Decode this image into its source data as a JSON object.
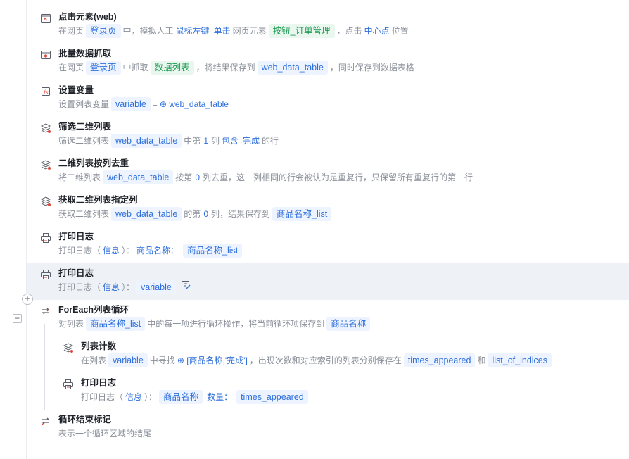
{
  "steps": [
    {
      "title": "点击元素(web)",
      "parts": [
        [
          "t",
          "在网页"
        ],
        [
          "tag",
          "登录页"
        ],
        [
          "t",
          "中，模拟人工"
        ],
        [
          "kw",
          "鼠标左键"
        ],
        [
          "kw",
          "单击"
        ],
        [
          "t",
          "网页元素"
        ],
        [
          "tg",
          "按钮_订单管理"
        ],
        [
          "t",
          "，点击"
        ],
        [
          "kw",
          "中心点"
        ],
        [
          "t",
          "位置"
        ]
      ]
    },
    {
      "title": "批量数据抓取",
      "parts": [
        [
          "t",
          "在网页"
        ],
        [
          "tag",
          "登录页"
        ],
        [
          "t",
          "中抓取"
        ],
        [
          "tg",
          "数据列表"
        ],
        [
          "t",
          "，将结果保存到"
        ],
        [
          "tag",
          "web_data_table"
        ],
        [
          "t",
          "，同时保存到数据表格"
        ]
      ]
    },
    {
      "title": "设置变量",
      "parts": [
        [
          "t",
          "设置列表变量"
        ],
        [
          "tag",
          "variable"
        ],
        [
          "t",
          "="
        ],
        [
          "kwi",
          "web_data_table"
        ]
      ]
    },
    {
      "title": "筛选二维列表",
      "parts": [
        [
          "t",
          "筛选二维列表"
        ],
        [
          "tag",
          "web_data_table"
        ],
        [
          "t",
          "中第"
        ],
        [
          "num",
          "1"
        ],
        [
          "t",
          "列"
        ],
        [
          "kw",
          "包含"
        ],
        [
          "kw",
          "完成"
        ],
        [
          "t",
          "的行"
        ]
      ]
    },
    {
      "title": "二维列表按列去重",
      "parts": [
        [
          "t",
          "将二维列表"
        ],
        [
          "tag",
          "web_data_table"
        ],
        [
          "t",
          "按第"
        ],
        [
          "num",
          "0"
        ],
        [
          "t",
          "列去重，这一列相同的行会被认为是重复行，只保留所有重复行的第一行"
        ]
      ]
    },
    {
      "title": "获取二维列表指定列",
      "parts": [
        [
          "t",
          "获取二维列表"
        ],
        [
          "tag",
          "web_data_table"
        ],
        [
          "t",
          "的第"
        ],
        [
          "num",
          "0"
        ],
        [
          "t",
          "列，结果保存到"
        ],
        [
          "tag",
          "商品名称_list"
        ]
      ]
    },
    {
      "title": "打印日志",
      "parts": [
        [
          "t",
          "打印日志（"
        ],
        [
          "kw",
          "信息"
        ],
        [
          "t",
          "）："
        ],
        [
          "kw",
          "商品名称："
        ],
        [
          "tag",
          "商品名称_list"
        ]
      ]
    },
    {
      "title": "打印日志",
      "parts": [
        [
          "t",
          "打印日志（"
        ],
        [
          "kw",
          "信息"
        ],
        [
          "t",
          "）："
        ],
        [
          "tag",
          "variable"
        ],
        [
          "edit",
          ""
        ]
      ]
    },
    {
      "title": "ForEach列表循环",
      "parts": [
        [
          "t",
          "对列表"
        ],
        [
          "tag",
          "商品名称_list"
        ],
        [
          "t",
          "中的每一项进行循环操作，将当前循环项保存到"
        ],
        [
          "tag",
          "商品名称"
        ]
      ]
    },
    {
      "title": "列表计数",
      "parts": [
        [
          "t",
          "在列表"
        ],
        [
          "tag",
          "variable"
        ],
        [
          "t",
          "中寻找"
        ],
        [
          "kwi",
          "[商品名称,'完成']"
        ],
        [
          "t",
          "，出现次数和对应索引的列表分别保存在"
        ],
        [
          "tag",
          "times_appeared"
        ],
        [
          "t",
          "和"
        ],
        [
          "tag",
          "list_of_indices"
        ]
      ]
    },
    {
      "title": "打印日志",
      "parts": [
        [
          "t",
          "打印日志（"
        ],
        [
          "kw",
          "信息"
        ],
        [
          "t",
          "）："
        ],
        [
          "tag",
          "商品名称"
        ],
        [
          "kw",
          "数量："
        ],
        [
          "tag",
          "times_appeared"
        ]
      ]
    },
    {
      "title": "循环结束标记",
      "parts": [
        [
          "t",
          "表示一个循环区域的结尾"
        ]
      ]
    }
  ],
  "icons": [
    "click-web-icon",
    "batch-scrape-icon",
    "set-variable-icon",
    "list-filter-icon",
    "list-dedupe-icon",
    "list-column-icon",
    "print-log-icon",
    "print-log-icon",
    "foreach-loop-icon",
    "list-count-icon",
    "print-log-icon",
    "loop-end-icon"
  ],
  "controls": {
    "add": "+",
    "collapse": "−"
  },
  "colors": {
    "accent": "#2d6fdc",
    "tag_bg": "#eef4ff",
    "green": "#1c9a52",
    "selected_bg": "#eef1f6"
  }
}
